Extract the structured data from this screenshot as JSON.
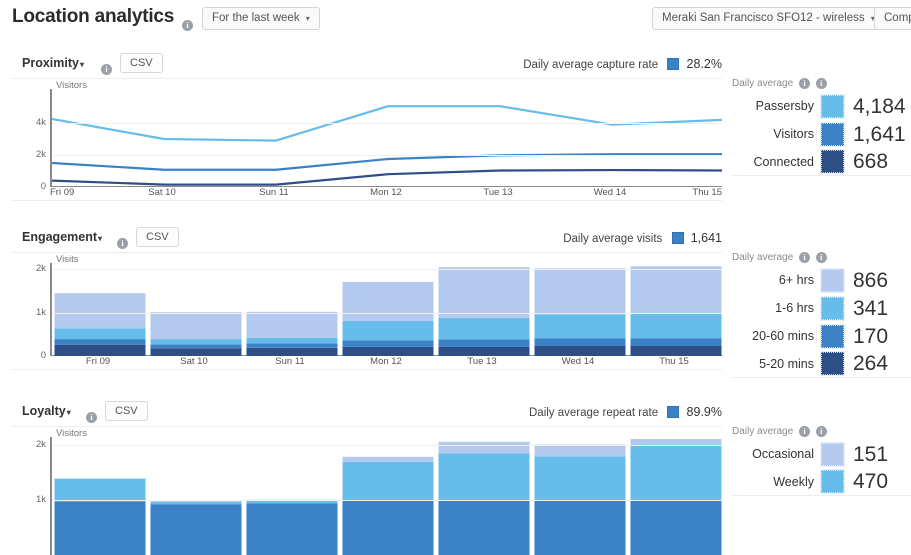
{
  "header": {
    "title": "Location analytics",
    "info_icon": "info-icon",
    "range_selector": {
      "label": "For the last week",
      "caret": "▾"
    },
    "network_selector": {
      "label": "Meraki San Francisco SFO12 - wireless",
      "caret": "▾"
    },
    "compare_button": {
      "label": "Comp"
    }
  },
  "colors": {
    "pale_blue": "#b3caee",
    "light_blue": "#67bde9",
    "mid_blue": "#3a81c6",
    "navy": "#2e4e86",
    "legend_blue": "#3a81c6",
    "axis": "#8a8a8a"
  },
  "labels": {
    "daily_average": "Daily average",
    "csv": "CSV",
    "caret": "▾"
  },
  "days": [
    "Fri 09",
    "Sat 10",
    "Sun 11",
    "Mon 12",
    "Tue 13",
    "Wed 14",
    "Thu 15"
  ],
  "sections": [
    {
      "key": "proximity",
      "title": "Proximity",
      "csv_label": "CSV",
      "legend_label": "Daily average capture rate",
      "legend_value": "28.2%",
      "rail_title": "Daily average",
      "rail": [
        {
          "label": "Passersby",
          "value": "4,184",
          "color": "#67bde9"
        },
        {
          "label": "Visitors",
          "value": "1,641",
          "color": "#3a81c6"
        },
        {
          "label": "Connected",
          "value": "668",
          "color": "#2e4e86"
        }
      ]
    },
    {
      "key": "engagement",
      "title": "Engagement",
      "csv_label": "CSV",
      "legend_label": "Daily average visits",
      "legend_value": "1,641",
      "rail_title": "Daily average",
      "rail": [
        {
          "label": "6+ hrs",
          "value": "866",
          "color": "#b3caee"
        },
        {
          "label": "1-6 hrs",
          "value": "341",
          "color": "#67bde9"
        },
        {
          "label": "20-60 mins",
          "value": "170",
          "color": "#3a81c6"
        },
        {
          "label": "5-20 mins",
          "value": "264",
          "color": "#2e4e86"
        }
      ]
    },
    {
      "key": "loyalty",
      "title": "Loyalty",
      "csv_label": "CSV",
      "legend_label": "Daily average repeat rate",
      "legend_value": "89.9%",
      "rail_title": "Daily average",
      "rail": [
        {
          "label": "Occasional",
          "value": "151",
          "color": "#b3caee"
        },
        {
          "label": "Weekly",
          "value": "470",
          "color": "#67bde9"
        }
      ]
    }
  ],
  "chart_data": [
    {
      "id": "proximity-chart",
      "type": "line",
      "title": "Proximity",
      "xlabel": "",
      "ylabel": "Visitors",
      "x": [
        "Fri 09",
        "Sat 10",
        "Sun 11",
        "Mon 12",
        "Tue 13",
        "Wed 14",
        "Thu 15"
      ],
      "ylim": [
        0,
        6000
      ],
      "yticks": [
        0,
        2000,
        4000
      ],
      "ytick_labels": [
        "0",
        "2k",
        "4k"
      ],
      "grid": true,
      "legend_position": "top-right",
      "series": [
        {
          "name": "Passersby",
          "color": "#67bde9",
          "values": [
            4250,
            3000,
            2900,
            5050,
            5050,
            3900,
            4200
          ]
        },
        {
          "name": "Visitors",
          "color": "#3a81c6",
          "values": [
            1500,
            1080,
            1080,
            1750,
            1980,
            2050,
            2050
          ]
        },
        {
          "name": "Connected",
          "color": "#2e4e86",
          "values": [
            400,
            150,
            150,
            800,
            1030,
            1060,
            1030
          ]
        }
      ]
    },
    {
      "id": "engagement-chart",
      "type": "bar",
      "bar_mode": "stacked",
      "title": "Engagement",
      "xlabel": "",
      "ylabel": "Visits",
      "categories": [
        "Fri 09",
        "Sat 10",
        "Sun 11",
        "Mon 12",
        "Tue 13",
        "Wed 14",
        "Thu 15"
      ],
      "ylim": [
        0,
        2100
      ],
      "yticks": [
        0,
        1000,
        2000
      ],
      "ytick_labels": [
        "0",
        "1k",
        "2k"
      ],
      "grid": true,
      "legend_position": "right",
      "series": [
        {
          "name": "5-20 mins",
          "color": "#2e4e86",
          "values": [
            260,
            180,
            190,
            210,
            215,
            230,
            230
          ]
        },
        {
          "name": "20-60 mins",
          "color": "#3a81c6",
          "values": [
            130,
            90,
            100,
            150,
            165,
            175,
            180
          ]
        },
        {
          "name": "1-6 hrs",
          "color": "#67bde9",
          "values": [
            250,
            120,
            130,
            450,
            500,
            560,
            590
          ]
        },
        {
          "name": "6+ hrs",
          "color": "#b3caee",
          "values": [
            810,
            620,
            600,
            900,
            1170,
            1060,
            1070
          ]
        }
      ]
    },
    {
      "id": "loyalty-chart",
      "type": "bar",
      "bar_mode": "stacked",
      "title": "Loyalty",
      "xlabel": "",
      "ylabel": "Visitors",
      "categories": [
        "Fri 09",
        "Sat 10",
        "Sun 11",
        "Mon 12",
        "Tue 13",
        "Wed 14",
        "Thu 15"
      ],
      "ylim": [
        0,
        2100
      ],
      "yticks": [
        1000,
        2000
      ],
      "ytick_labels": [
        "1k",
        "2k"
      ],
      "grid": true,
      "clipped_bottom": true,
      "legend_position": "right",
      "series": [
        {
          "name": "Weekly",
          "color": "#3a81c6",
          "values": [
            980,
            930,
            945,
            1000,
            1000,
            1000,
            1000
          ]
        },
        {
          "name": "Occasional_mid",
          "color": "#67bde9",
          "values": [
            410,
            40,
            45,
            690,
            840,
            790,
            1000
          ]
        },
        {
          "name": "Occasional",
          "color": "#b3caee",
          "values": [
            0,
            15,
            20,
            90,
            210,
            210,
            100
          ]
        }
      ]
    }
  ]
}
